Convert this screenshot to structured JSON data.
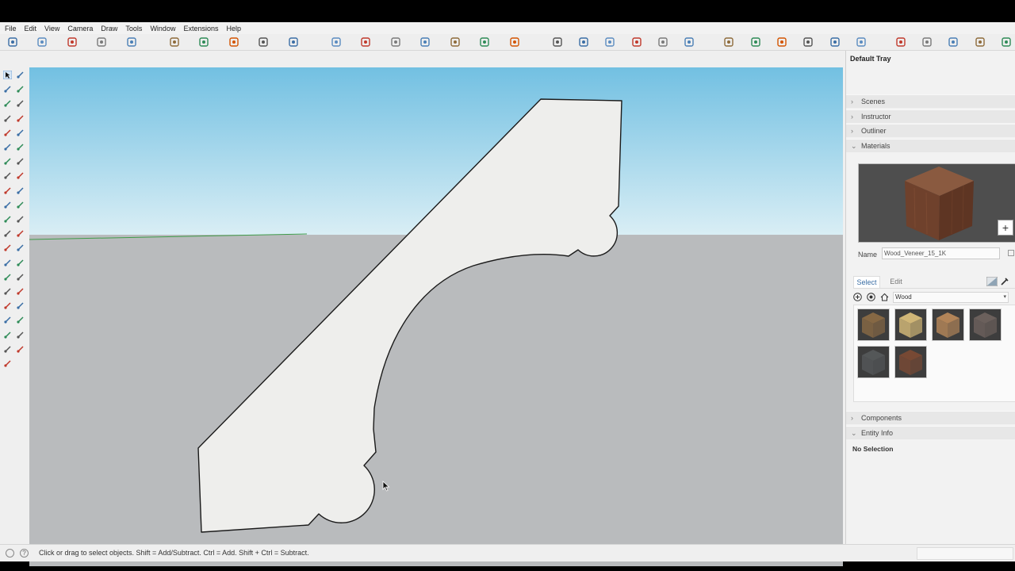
{
  "menu": [
    "File",
    "Edit",
    "View",
    "Camera",
    "Draw",
    "Tools",
    "Window",
    "Extensions",
    "Help"
  ],
  "toolbar_icons": [
    "orbit-icon",
    "pan-icon",
    "zoom-icon",
    "zoom-extents-icon",
    "components-icon",
    "group-icon",
    "move-icon",
    "rotate-icon",
    "push-pull-icon",
    "follow-me-icon",
    "offset-icon",
    "tape-icon",
    "dimension-icon",
    "protractor-icon",
    "text-icon",
    "axes-icon",
    "section-plane-icon",
    "xray-icon",
    "wireframe-icon",
    "hidden-line-icon",
    "shaded-icon",
    "textured-icon",
    "monochrome-icon",
    "solid-tools-icon",
    "sandbox-icon",
    "views-icon",
    "styles-icon",
    "shadows-icon",
    "fog-icon",
    "warehouse-icon",
    "extension-warehouse-icon",
    "layout-icon",
    "settings-icon",
    "account-icon"
  ],
  "left_tools": [
    "select-icon",
    "lasso-icon",
    "make-component-icon",
    "eraser-icon",
    "paint-bucket-icon",
    "tag-icon",
    "line-icon",
    "freehand-icon",
    "rectangle-icon",
    "rotated-rectangle-icon",
    "circle-icon",
    "polygon-icon",
    "arc-icon",
    "pie-icon",
    "two-point-arc-icon",
    "three-point-arc-icon",
    "move-icon",
    "push-pull-icon",
    "rotate-icon",
    "follow-me-icon",
    "scale-icon",
    "offset-icon",
    "tape-measure-icon",
    "dimension-icon",
    "protractor-icon",
    "text-icon",
    "axes-icon",
    "3d-text-icon",
    "orbit-icon",
    "pan-icon",
    "zoom-icon",
    "zoom-window-icon",
    "zoom-extents-icon",
    "previous-view-icon",
    "walk-icon",
    "look-around-icon",
    "position-camera-icon",
    "section-plane-icon",
    "display-section-icon",
    "warehouse-icon",
    "extension-icon"
  ],
  "status": {
    "text": "Click or drag to select objects. Shift = Add/Subtract. Ctrl = Add. Shift + Ctrl = Subtract."
  },
  "tray": {
    "title": "Default Tray",
    "panels": {
      "scenes": "Scenes",
      "instructor": "Instructor",
      "outliner": "Outliner",
      "materials": "Materials",
      "components": "Components",
      "entity_info": "Entity Info"
    },
    "materials": {
      "name_label": "Name",
      "name_value": "Wood_Veneer_15_1K",
      "tab_select": "Select",
      "tab_edit": "Edit",
      "library": "Wood",
      "swatches": [
        {
          "name": "wood-swatch-1",
          "color": "#8a6a45"
        },
        {
          "name": "wood-swatch-2",
          "color": "#d8bd7a"
        },
        {
          "name": "wood-swatch-3",
          "color": "#b8885a"
        },
        {
          "name": "wood-swatch-4",
          "color": "#6e625e"
        },
        {
          "name": "wood-swatch-5",
          "color": "#55585a"
        },
        {
          "name": "wood-swatch-6",
          "color": "#7a4a34"
        }
      ]
    },
    "entity_info": {
      "selection": "No Selection"
    }
  },
  "colors": {
    "sky_top": "#7ec6e4",
    "sky_bottom": "#d6ecf3",
    "ground": "#b9bbbd",
    "profile_fill": "#efefed",
    "wood": "#7a4a34"
  }
}
